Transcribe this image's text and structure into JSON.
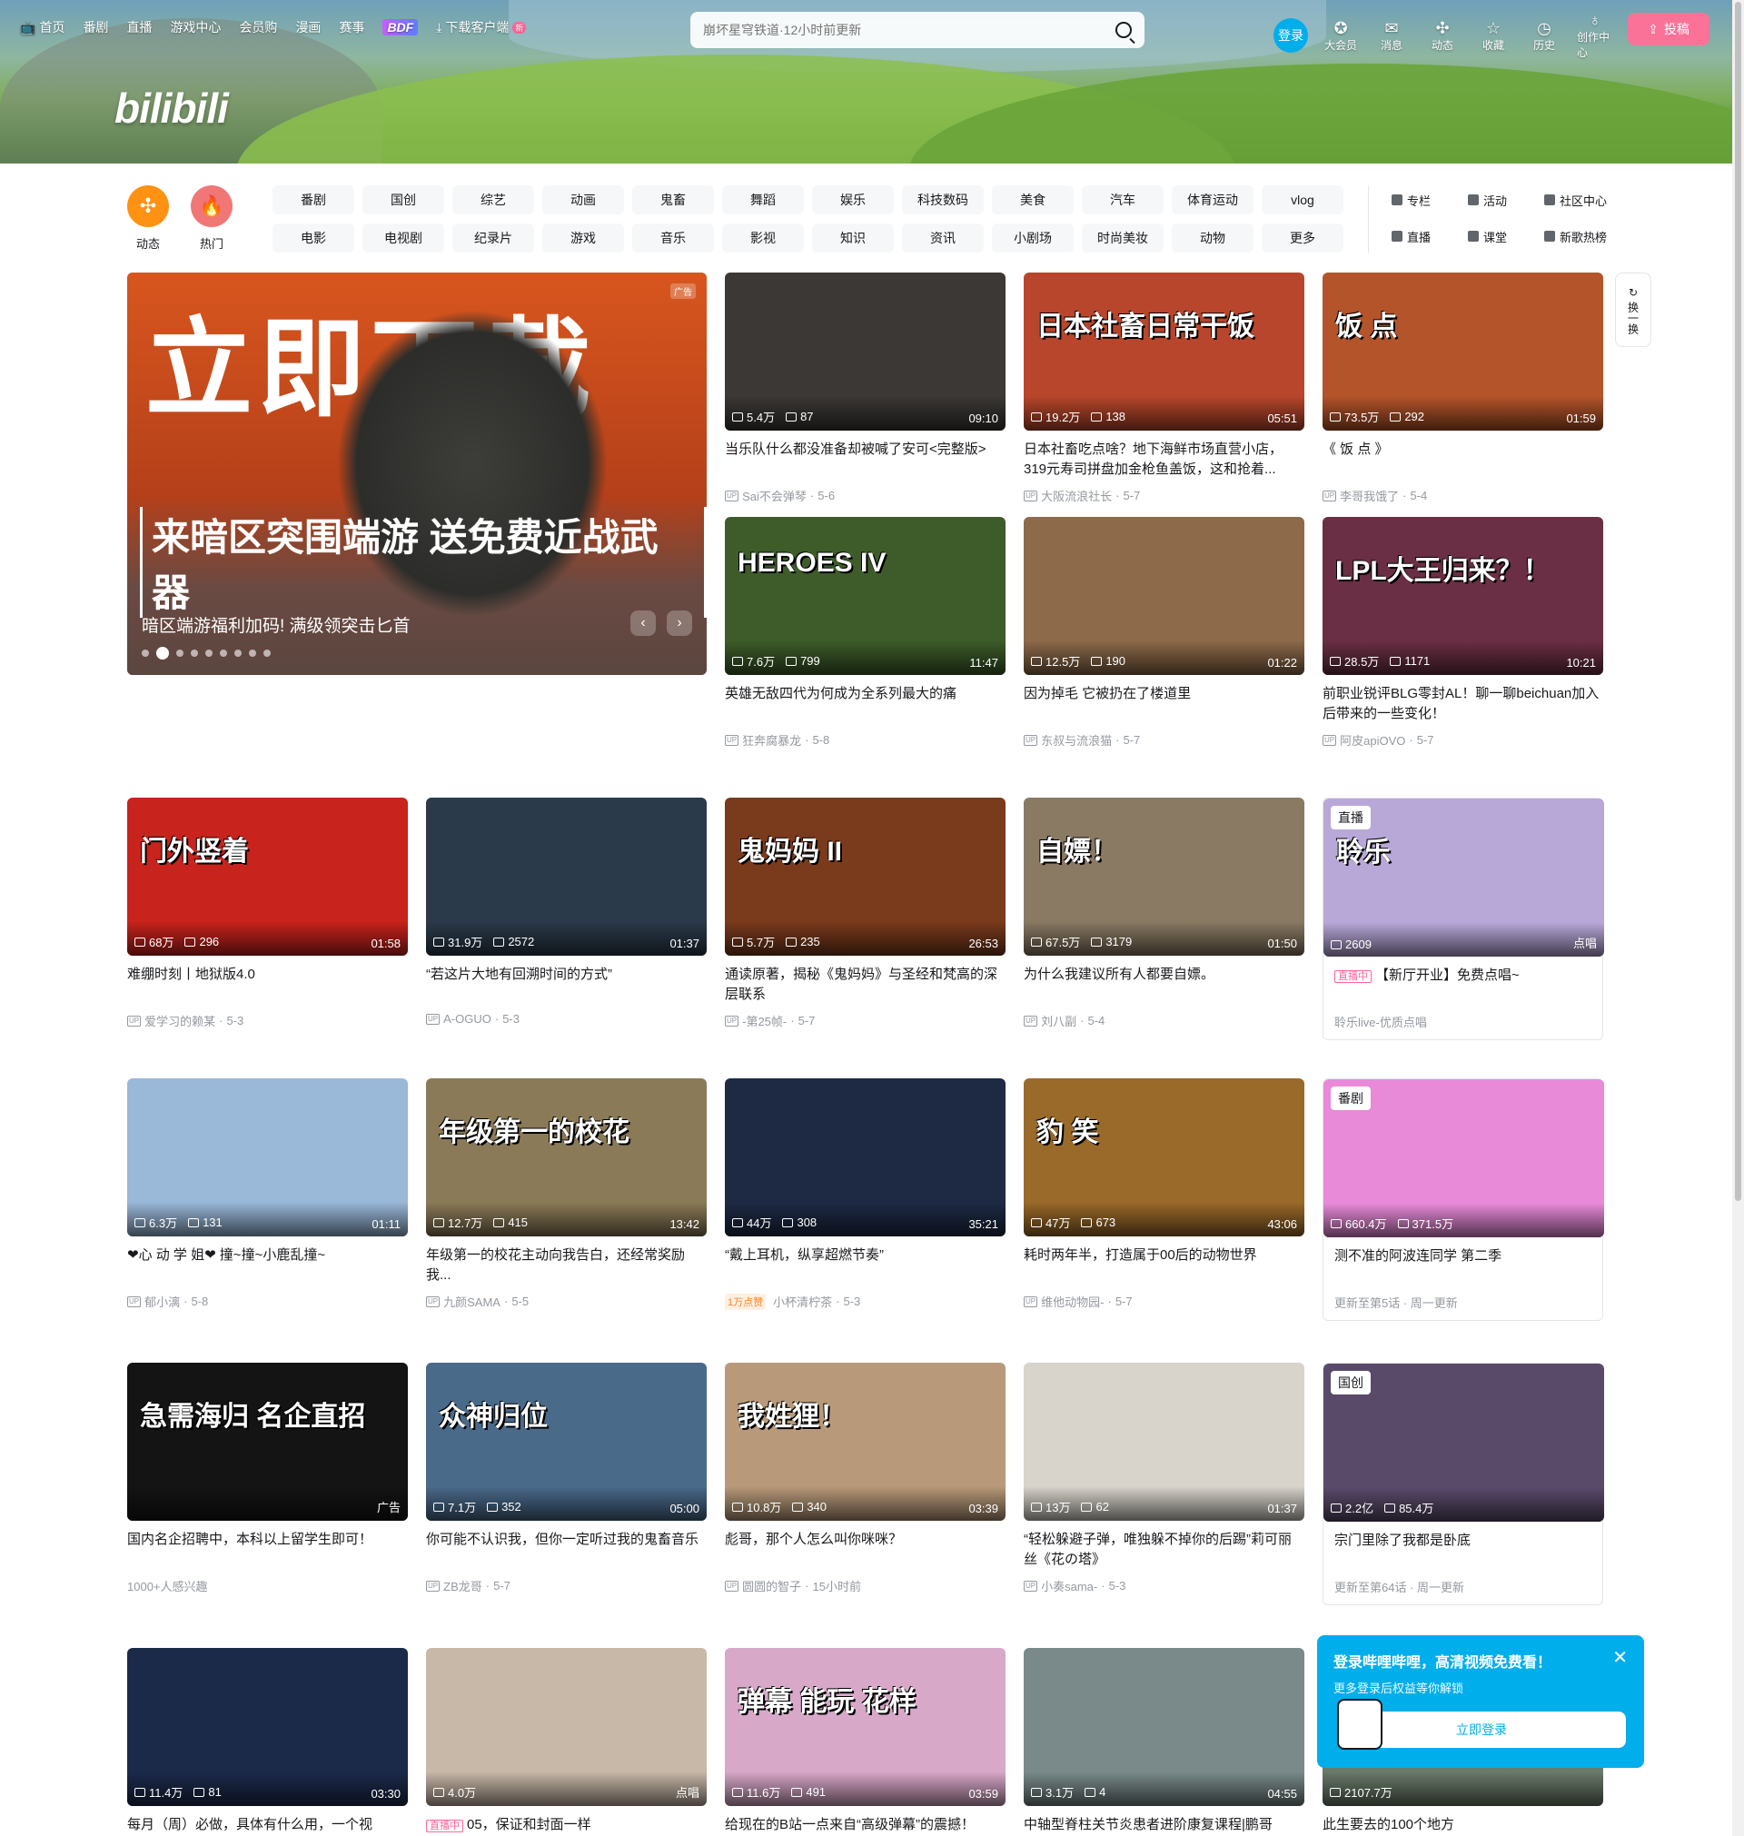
{
  "header": {
    "logo_text": "bilibili",
    "nav": [
      "首页",
      "番剧",
      "直播",
      "游戏中心",
      "会员购",
      "漫画",
      "赛事"
    ],
    "bdf_label": "BDF",
    "download_label": "下载客户端",
    "download_new": "新",
    "search_placeholder": "崩坏星穹铁道·12小时前更新",
    "login_label": "登录",
    "right_items": [
      {
        "icon": "vip-icon",
        "glyph": "✪",
        "label": "大会员"
      },
      {
        "icon": "message-icon",
        "glyph": "✉",
        "label": "消息"
      },
      {
        "icon": "dynamic-icon",
        "glyph": "✣",
        "label": "动态"
      },
      {
        "icon": "favorite-icon",
        "glyph": "☆",
        "label": "收藏"
      },
      {
        "icon": "history-icon",
        "glyph": "◷",
        "label": "历史"
      },
      {
        "icon": "creator-icon",
        "glyph": "♁",
        "label": "创作中心"
      }
    ],
    "upload_label": "投稿"
  },
  "channels": {
    "dynamic_label": "动态",
    "hot_label": "热门",
    "items": [
      "番剧",
      "国创",
      "综艺",
      "动画",
      "鬼畜",
      "舞蹈",
      "娱乐",
      "科技数码",
      "美食",
      "汽车",
      "体育运动",
      "vlog",
      "电影",
      "电视剧",
      "纪录片",
      "游戏",
      "音乐",
      "影视",
      "知识",
      "资讯",
      "小剧场",
      "时尚美妆",
      "动物",
      "更多"
    ],
    "quick": [
      "专栏",
      "活动",
      "社区中心",
      "直播",
      "课堂",
      "新歌热榜"
    ]
  },
  "carousel": {
    "big_text": "立即下载",
    "sub_text": "来暗区突围端游 送免费近战武器",
    "caption": "暗区端游福利加码! 满级领突击匕首",
    "ad_tag": "广告",
    "dot_count": 9
  },
  "refresh_label": "换一换",
  "videos": [
    {
      "title": "当乐队什么都没准备却被喊了安可<完整版>",
      "views": "5.4万",
      "danmaku": "87",
      "duration": "09:10",
      "up": "Sai不会弹琴",
      "date": "5-6",
      "bg": "#3b3835",
      "overlay": ""
    },
    {
      "title": "日本社畜吃点啥？地下海鲜市场直营小店，319元寿司拼盘加金枪鱼盖饭，这和抢着...",
      "views": "19.2万",
      "danmaku": "138",
      "duration": "05:51",
      "up": "大阪流浪社长",
      "date": "5-7",
      "bg": "#b8462c",
      "overlay": "日本社畜日常干饭"
    },
    {
      "title": "《 饭 点 》",
      "views": "73.5万",
      "danmaku": "292",
      "duration": "01:59",
      "up": "李哥我饿了",
      "date": "5-4",
      "bg": "#b4542a",
      "overlay": "饭 点"
    },
    {
      "title": "英雄无敌四代为何成为全系列最大的痛",
      "views": "7.6万",
      "danmaku": "799",
      "duration": "11:47",
      "up": "狂奔腐暴龙",
      "date": "5-8",
      "bg": "#3d5c2a",
      "overlay": "HEROES IV"
    },
    {
      "title": "因为掉毛 它被扔在了楼道里",
      "views": "12.5万",
      "danmaku": "190",
      "duration": "01:22",
      "up": "东叔与流浪猫",
      "date": "5-7",
      "bg": "#8c6a4a",
      "overlay": ""
    },
    {
      "title": "前职业锐评BLG零封AL！聊一聊beichuan加入后带来的一些变化！",
      "views": "28.5万",
      "danmaku": "1171",
      "duration": "10:21",
      "up": "阿皮apiOVO",
      "date": "5-7",
      "bg": "#6a2f44",
      "overlay": "LPL大王归来？！"
    },
    {
      "title": "难绷时刻丨地狱版4.0",
      "views": "68万",
      "danmaku": "296",
      "duration": "01:58",
      "up": "爱学习的赖某",
      "date": "5-3",
      "bg": "#c8231c",
      "overlay": "门外竖着"
    },
    {
      "title": "“若这片大地有回溯时间的方式”",
      "views": "31.9万",
      "danmaku": "2572",
      "duration": "01:37",
      "up": "A-OGUO",
      "date": "5-3",
      "bg": "#2b3a4a",
      "overlay": ""
    },
    {
      "title": "通读原著，揭秘《鬼妈妈》与圣经和梵高的深层联系",
      "views": "5.7万",
      "danmaku": "235",
      "duration": "26:53",
      "up": "-第25帧-",
      "date": "5-7",
      "bg": "#7a3a1c",
      "overlay": "鬼妈妈 II"
    },
    {
      "title": "为什么我建议所有人都要自嫖。",
      "views": "67.5万",
      "danmaku": "3179",
      "duration": "01:50",
      "up": "刘八副",
      "date": "5-4",
      "bg": "#8a7a64",
      "overlay": "自嫖！"
    },
    {
      "title": "【新厅开业】免费点唱~",
      "views": "2609",
      "danmaku": "",
      "duration": "点唱",
      "up": "聆乐live-优质点唱",
      "date": "",
      "bg": "#b8a8d8",
      "overlay": "聆乐",
      "badge": "直播",
      "live": "直播中"
    },
    {
      "title": "❤心 动 学 姐❤ 撞~撞~小鹿乱撞~",
      "views": "6.3万",
      "danmaku": "131",
      "duration": "01:11",
      "up": "郁小漓",
      "date": "5-8",
      "bg": "#9ab8d8",
      "overlay": ""
    },
    {
      "title": "年级第一的校花主动向我告白，还经常奖励我...",
      "views": "12.7万",
      "danmaku": "415",
      "duration": "13:42",
      "up": "九颜SAMA",
      "date": "5-5",
      "bg": "#8a7a58",
      "overlay": "年级第一的校花"
    },
    {
      "title": "“戴上耳机，纵享超燃节奏”",
      "views": "44万",
      "danmaku": "308",
      "duration": "35:21",
      "up": "小杯清柠茶",
      "date": "5-3",
      "bg": "#1e2a44",
      "overlay": "",
      "hot": "1万点赞"
    },
    {
      "title": "耗时两年半，打造属于00后的动物世界",
      "views": "47万",
      "danmaku": "673",
      "duration": "43:06",
      "up": "维他动物园-",
      "date": "5-7",
      "bg": "#9a6a2a",
      "overlay": "豹  笑"
    },
    {
      "title": "测不准的阿波连同学 第二季",
      "views": "660.4万",
      "danmaku": "371.5万",
      "duration": "",
      "up": "更新至第5话 · 周一更新",
      "date": "",
      "bg": "#e88ad8",
      "overlay": "",
      "badge": "番剧"
    },
    {
      "title": "国内名企招聘中，本科以上留学生即可！",
      "views": "",
      "danmaku": "",
      "duration": "广告",
      "up": "1000+人感兴趣",
      "date": "",
      "bg": "#141414",
      "overlay": "急需海归 名企直招"
    },
    {
      "title": "你可能不认识我，但你一定听过我的鬼畜音乐",
      "views": "7.1万",
      "danmaku": "352",
      "duration": "05:00",
      "up": "ZB龙哥",
      "date": "5-7",
      "bg": "#4a6a8a",
      "overlay": "众神归位"
    },
    {
      "title": "彪哥，那个人怎么叫你咪咪？",
      "views": "10.8万",
      "danmaku": "340",
      "duration": "03:39",
      "up": "圆圆的智子",
      "date": "15小时前",
      "bg": "#b89a7a",
      "overlay": "我姓狸！"
    },
    {
      "title": "“轻松躲避子弹，唯独躲不掉你的后踢”莉可丽丝《花の塔》",
      "views": "13万",
      "danmaku": "62",
      "duration": "01:37",
      "up": "小奏sama-",
      "date": "5-3",
      "bg": "#d8d4cc",
      "overlay": ""
    },
    {
      "title": "宗门里除了我都是卧底",
      "views": "2.2亿",
      "danmaku": "85.4万",
      "duration": "",
      "up": "更新至第64话 · 周一更新",
      "date": "",
      "bg": "#5a4a6a",
      "overlay": "",
      "badge": "国创"
    },
    {
      "title": "每月（周）必做，具体有什么用，一个视",
      "views": "11.4万",
      "danmaku": "81",
      "duration": "03:30",
      "up": "",
      "date": "",
      "bg": "#1c2a4a",
      "overlay": ""
    },
    {
      "title": "05，保证和封面一样",
      "views": "4.0万",
      "danmaku": "",
      "duration": "点唱",
      "up": "",
      "date": "",
      "bg": "#c8b8a8",
      "overlay": "",
      "live": "直播中"
    },
    {
      "title": "给现在的B站一点来自“高级弹幕”的震撼！",
      "views": "11.6万",
      "danmaku": "491",
      "duration": "03:59",
      "up": "",
      "date": "",
      "bg": "#d8a8c8",
      "overlay": "弹幕 能玩 花样"
    },
    {
      "title": "中轴型脊柱关节炎患者进阶康复课程|鹏哥",
      "views": "3.1万",
      "danmaku": "4",
      "duration": "04:55",
      "up": "",
      "date": "",
      "bg": "#7a8a8a",
      "overlay": ""
    },
    {
      "title": "此生要去的100个地方",
      "views": "2107.7万",
      "danmaku": "",
      "duration": "",
      "up": "",
      "date": "",
      "bg": "#6a7a6a",
      "overlay": ""
    }
  ],
  "login_popup": {
    "heading": "登录哔哩哔哩，高清视频免费看！",
    "sub": "更多登录后权益等你解锁",
    "button": "立即登录"
  }
}
